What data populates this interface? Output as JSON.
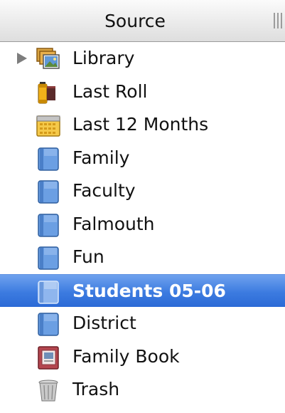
{
  "header": {
    "title": "Source"
  },
  "items": [
    {
      "label": "Library",
      "icon": "library-icon",
      "selected": false,
      "expandable": true
    },
    {
      "label": "Last Roll",
      "icon": "film-roll-icon",
      "selected": false
    },
    {
      "label": "Last 12 Months",
      "icon": "calendar-icon",
      "selected": false
    },
    {
      "label": "Family",
      "icon": "album-icon",
      "selected": false
    },
    {
      "label": "Faculty",
      "icon": "album-icon",
      "selected": false
    },
    {
      "label": "Falmouth",
      "icon": "album-icon",
      "selected": false
    },
    {
      "label": "Fun",
      "icon": "album-icon",
      "selected": false
    },
    {
      "label": "Students 05-06",
      "icon": "album-icon",
      "selected": true
    },
    {
      "label": "District",
      "icon": "album-icon",
      "selected": false
    },
    {
      "label": "Family Book",
      "icon": "book-icon",
      "selected": false
    },
    {
      "label": "Trash",
      "icon": "trash-icon",
      "selected": false
    }
  ],
  "colors": {
    "selection": "#3c7be0",
    "album_blue": "#6b9fe3"
  }
}
